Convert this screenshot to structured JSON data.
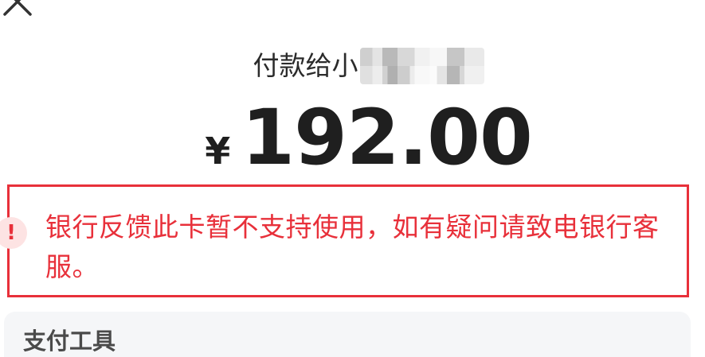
{
  "header": {
    "close_icon": "close-icon"
  },
  "payment": {
    "payee_prefix": "付款给小",
    "currency_symbol": "¥",
    "amount": "192.00"
  },
  "notice": {
    "icon": "warning-icon",
    "message": "银行反馈此卡暂不支持使用，如有疑问请致电银行客服。",
    "color": "#e8303a"
  },
  "payment_tools": {
    "title": "支付工具"
  }
}
